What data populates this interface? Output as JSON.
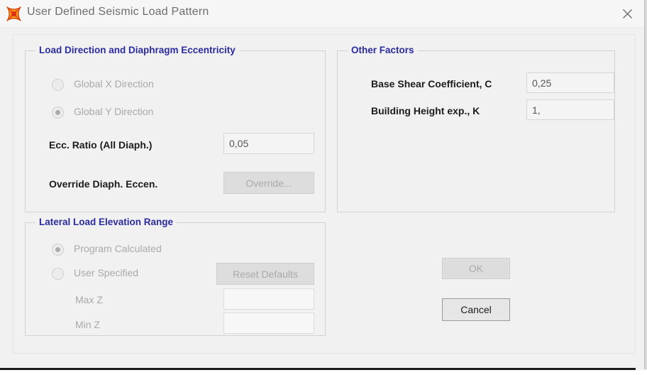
{
  "window": {
    "title": "User Defined Seismic Load Pattern",
    "icon": "etabs-star-icon",
    "close_label": "close-icon",
    "accent_legend_color": "#2b2b9e"
  },
  "load_direction_group": {
    "legend": "Load Direction and Diaphragm Eccentricity",
    "radios": [
      {
        "label": "Global  X  Direction",
        "selected": false,
        "enabled": false
      },
      {
        "label": "Global  Y  Direction",
        "selected": true,
        "enabled": false
      }
    ],
    "ecc_ratio_label": "Ecc. Ratio (All Diaph.)",
    "ecc_ratio_value": "0,05",
    "override_label": "Override Diaph. Eccen.",
    "override_button": "Override...",
    "override_button_enabled": false
  },
  "elevation_group": {
    "legend": "Lateral Load Elevation Range",
    "radios": [
      {
        "label": "Program Calculated",
        "selected": true,
        "enabled": false
      },
      {
        "label": "User Specified",
        "selected": false,
        "enabled": false
      }
    ],
    "reset_button": "Reset Defaults",
    "reset_button_enabled": false,
    "max_z_label": "Max Z",
    "max_z_value": "",
    "min_z_label": "Min Z",
    "min_z_value": ""
  },
  "other_factors_group": {
    "legend": "Other Factors",
    "base_shear_label": "Base Shear Coefficient, C",
    "base_shear_value": "0,25",
    "height_exp_label": "Building Height exp., K",
    "height_exp_value": "1,"
  },
  "actions": {
    "ok_label": "OK",
    "ok_enabled": false,
    "cancel_label": "Cancel",
    "cancel_enabled": true
  }
}
